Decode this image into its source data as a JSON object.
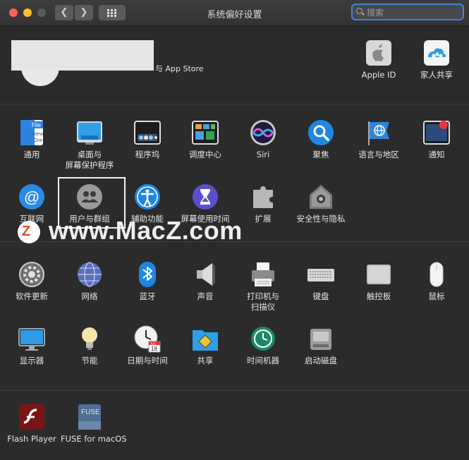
{
  "window": {
    "title": "系统偏好设置"
  },
  "search": {
    "placeholder": "搜索"
  },
  "account": {
    "store_label": "与 App Store"
  },
  "top_right": [
    {
      "label": "Apple ID",
      "icon": "apple-id-icon"
    },
    {
      "label": "家人共享",
      "icon": "family-sharing-icon"
    }
  ],
  "row1": [
    {
      "label": "通用",
      "icon": "general-icon"
    },
    {
      "label": "桌面与\n屏幕保护程序",
      "icon": "desktop-screensaver-icon"
    },
    {
      "label": "程序坞",
      "icon": "dock-icon"
    },
    {
      "label": "调度中心",
      "icon": "mission-control-icon"
    },
    {
      "label": "Siri",
      "icon": "siri-icon"
    },
    {
      "label": "聚焦",
      "icon": "spotlight-icon"
    },
    {
      "label": "语言与地区",
      "icon": "language-region-icon"
    },
    {
      "label": "通知",
      "icon": "notifications-icon"
    }
  ],
  "row2": [
    {
      "label": "互联网",
      "icon": "internet-accounts-icon"
    },
    {
      "label": "用户与群组",
      "icon": "users-groups-icon"
    },
    {
      "label": "辅助功能",
      "icon": "accessibility-icon"
    },
    {
      "label": "屏幕使用时间",
      "icon": "screen-time-icon"
    },
    {
      "label": "扩展",
      "icon": "extensions-icon"
    },
    {
      "label": "安全性与隐私",
      "icon": "security-privacy-icon"
    }
  ],
  "row3": [
    {
      "label": "软件更新",
      "icon": "software-update-icon"
    },
    {
      "label": "网络",
      "icon": "network-icon"
    },
    {
      "label": "蓝牙",
      "icon": "bluetooth-icon"
    },
    {
      "label": "声音",
      "icon": "sound-icon"
    },
    {
      "label": "打印机与\n扫描仪",
      "icon": "printer-scanner-icon"
    },
    {
      "label": "键盘",
      "icon": "keyboard-icon"
    },
    {
      "label": "触控板",
      "icon": "trackpad-icon"
    },
    {
      "label": "鼠标",
      "icon": "mouse-icon"
    }
  ],
  "row4": [
    {
      "label": "显示器",
      "icon": "displays-icon"
    },
    {
      "label": "节能",
      "icon": "energy-saver-icon"
    },
    {
      "label": "日期与时间",
      "icon": "date-time-icon"
    },
    {
      "label": "共享",
      "icon": "sharing-icon"
    },
    {
      "label": "时间机器",
      "icon": "time-machine-icon"
    },
    {
      "label": "启动磁盘",
      "icon": "startup-disk-icon"
    }
  ],
  "other": [
    {
      "label": "Flash Player",
      "icon": "flash-player-icon"
    },
    {
      "label": "FUSE for macOS",
      "icon": "fuse-icon"
    }
  ],
  "icon_text": {
    "file": "File",
    "new": "New",
    "one": "One",
    "fuse": "FUSE",
    "cal_month": "JUL",
    "cal_day": "18"
  },
  "watermark": {
    "logo": "Z",
    "text": "www.MacZ.com"
  },
  "colors": {
    "close": "#fe5f57",
    "minimize": "#febc2e",
    "zoom": "#5b5b5d",
    "accent": "#3f86d6",
    "background": "#2b2b2c"
  }
}
